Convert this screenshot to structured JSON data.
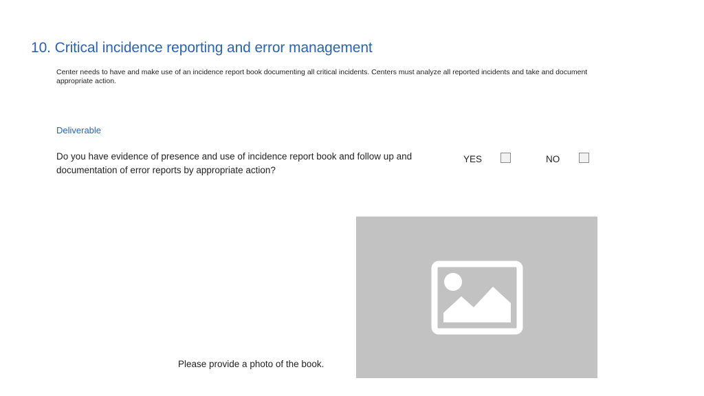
{
  "section": {
    "title": "10. Critical incidence reporting and error management",
    "description": "Center needs to have and make use of an incidence report book documenting all critical incidents. Centers must analyze all reported incidents and take and document appropriate action."
  },
  "deliverable": {
    "label": "Deliverable",
    "question": "Do you have evidence of presence and use of incidence report book and follow up and documentation of error reports by appropriate action?",
    "options": {
      "yes_label": "YES",
      "no_label": "NO"
    }
  },
  "photo": {
    "prompt": "Please provide a photo of the book.",
    "placeholder_icon": "image-placeholder-icon"
  },
  "colors": {
    "accent": "#2a62b8",
    "placeholder_bg": "#c2c2c2",
    "placeholder_icon": "#ffffff"
  }
}
